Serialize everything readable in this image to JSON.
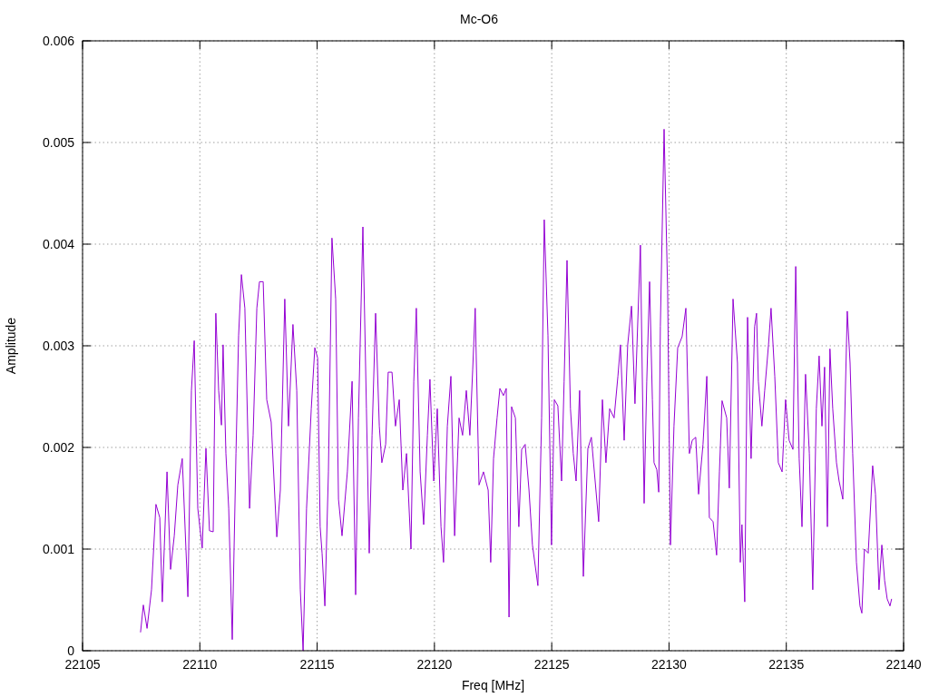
{
  "chart": {
    "chart_data": {
      "type": "line",
      "grid": true,
      "title": "Mc-O6",
      "xlabel": "Freq [MHz]",
      "ylabel": "Amplitude",
      "xlim": [
        22105,
        22140
      ],
      "ylim": [
        0,
        0.006
      ],
      "xticks": [
        22105,
        22110,
        22115,
        22120,
        22125,
        22130,
        22135,
        22140
      ],
      "yticks": [
        0,
        0.001,
        0.002,
        0.003,
        0.004,
        0.005,
        0.006
      ],
      "x": [
        22107.47,
        22107.59,
        22107.75,
        22107.94,
        22108.13,
        22108.29,
        22108.4,
        22108.6,
        22108.75,
        22108.91,
        22109.06,
        22109.25,
        22109.49,
        22109.64,
        22109.76,
        22109.91,
        22110.1,
        22110.26,
        22110.41,
        22110.57,
        22110.68,
        22110.8,
        22110.92,
        22110.99,
        22111.11,
        22111.23,
        22111.38,
        22111.54,
        22111.65,
        22111.77,
        22111.92,
        22112.12,
        22112.27,
        22112.43,
        22112.54,
        22112.7,
        22112.85,
        22113.04,
        22113.28,
        22113.43,
        22113.62,
        22113.78,
        22113.97,
        22114.13,
        22114.28,
        22114.4,
        22114.55,
        22114.75,
        22114.9,
        22115.02,
        22115.13,
        22115.21,
        22115.33,
        22115.48,
        22115.63,
        22115.79,
        22115.91,
        22116.06,
        22116.29,
        22116.49,
        22116.64,
        22116.76,
        22116.95,
        22117.1,
        22117.22,
        22117.34,
        22117.49,
        22117.65,
        22117.76,
        22117.92,
        22118.03,
        22118.19,
        22118.34,
        22118.5,
        22118.65,
        22118.81,
        22119,
        22119.12,
        22119.23,
        22119.39,
        22119.54,
        22119.7,
        22119.81,
        22119.97,
        22120.12,
        22120.28,
        22120.39,
        22120.55,
        22120.7,
        22120.86,
        22121.05,
        22121.2,
        22121.36,
        22121.51,
        22121.63,
        22121.74,
        22121.9,
        22122.09,
        22122.29,
        22122.4,
        22122.52,
        22122.67,
        22122.79,
        22122.94,
        22123.06,
        22123.18,
        22123.29,
        22123.45,
        22123.6,
        22123.72,
        22123.87,
        22124.03,
        22124.18,
        22124.41,
        22124.57,
        22124.68,
        22124.84,
        22124.99,
        22125.11,
        22125.26,
        22125.42,
        22125.53,
        22125.65,
        22125.8,
        22125.92,
        22126.04,
        22126.19,
        22126.35,
        22126.54,
        22126.69,
        22126.85,
        22127,
        22127.16,
        22127.31,
        22127.47,
        22127.66,
        22127.82,
        22127.93,
        22128.09,
        22128.24,
        22128.4,
        22128.55,
        22128.78,
        22128.94,
        22129.05,
        22129.17,
        22129.29,
        22129.36,
        22129.48,
        22129.56,
        22129.63,
        22129.79,
        22129.94,
        22130.06,
        22130.21,
        22130.37,
        22130.56,
        22130.72,
        22130.87,
        22130.99,
        22131.14,
        22131.26,
        22131.45,
        22131.61,
        22131.72,
        22131.88,
        22132.03,
        22132.15,
        22132.26,
        22132.46,
        22132.57,
        22132.73,
        22132.92,
        22133.04,
        22133.11,
        22133.23,
        22133.35,
        22133.5,
        22133.65,
        22133.73,
        22133.81,
        22133.96,
        22134.08,
        22134.24,
        22134.35,
        22134.51,
        22134.66,
        22134.82,
        22134.97,
        22135.12,
        22135.28,
        22135.4,
        22135.55,
        22135.67,
        22135.82,
        22135.98,
        22136.13,
        22136.28,
        22136.4,
        22136.52,
        22136.63,
        22136.75,
        22136.86,
        22136.98,
        22137.14,
        22137.25,
        22137.41,
        22137.6,
        22137.72,
        22137.83,
        22137.99,
        22138.14,
        22138.22,
        22138.33,
        22138.49,
        22138.68,
        22138.8,
        22138.95,
        22139.07,
        22139.19,
        22139.3,
        22139.42,
        22139.49
      ],
      "series": [
        {
          "color": "#9400d3",
          "values": [
            0.00018,
            0.00045,
            0.00022,
            0.0006,
            0.00144,
            0.00131,
            0.00048,
            0.00176,
            0.0008,
            0.00113,
            0.00163,
            0.00189,
            0.00053,
            0.00256,
            0.00305,
            0.0014,
            0.00101,
            0.00199,
            0.00118,
            0.00117,
            0.00332,
            0.00256,
            0.00222,
            0.00301,
            0.00194,
            0.0014,
            0.00011,
            0.00194,
            0.0031,
            0.0037,
            0.00337,
            0.0014,
            0.00212,
            0.00337,
            0.00363,
            0.00363,
            0.00247,
            0.00225,
            0.00112,
            0.00158,
            0.00346,
            0.00221,
            0.00321,
            0.00256,
            0.0006,
            0,
            0.0014,
            0.00238,
            0.00298,
            0.00288,
            0.00122,
            0.00096,
            0.00044,
            0.00176,
            0.00406,
            0.00346,
            0.00149,
            0.00113,
            0.00176,
            0.00265,
            0.00055,
            0.00229,
            0.00417,
            0.00238,
            0.00096,
            0.00212,
            0.00332,
            0.00221,
            0.00185,
            0.00203,
            0.00274,
            0.00274,
            0.00221,
            0.00247,
            0.00158,
            0.00194,
            0.001,
            0.00265,
            0.00337,
            0.00176,
            0.00124,
            0.00212,
            0.00267,
            0.00167,
            0.00238,
            0.00122,
            0.00087,
            0.00221,
            0.0027,
            0.00113,
            0.00229,
            0.00212,
            0.00256,
            0.00212,
            0.00276,
            0.00337,
            0.00163,
            0.00176,
            0.00158,
            0.00087,
            0.00189,
            0.00229,
            0.00258,
            0.00251,
            0.00258,
            0.00033,
            0.0024,
            0.00229,
            0.00122,
            0.00198,
            0.00203,
            0.00158,
            0.00104,
            0.00064,
            0.00229,
            0.00424,
            0.0031,
            0.00104,
            0.00247,
            0.00241,
            0.00167,
            0.00265,
            0.00384,
            0.00238,
            0.00194,
            0.00167,
            0.00256,
            0.00073,
            0.00199,
            0.0021,
            0.00167,
            0.00127,
            0.00247,
            0.00185,
            0.00238,
            0.00229,
            0.0027,
            0.00301,
            0.00207,
            0.00301,
            0.00339,
            0.00243,
            0.00399,
            0.00145,
            0.00265,
            0.00363,
            0.00247,
            0.00185,
            0.00178,
            0.00156,
            0.00319,
            0.00513,
            0.00355,
            0.00104,
            0.00221,
            0.00298,
            0.00309,
            0.00337,
            0.00194,
            0.00207,
            0.0021,
            0.00154,
            0.00203,
            0.0027,
            0.00131,
            0.00127,
            0.00094,
            0.00176,
            0.00246,
            0.00229,
            0.0016,
            0.00346,
            0.00283,
            0.00087,
            0.00124,
            0.00048,
            0.00328,
            0.00189,
            0.00319,
            0.00332,
            0.00265,
            0.00221,
            0.00256,
            0.00301,
            0.00337,
            0.0027,
            0.00185,
            0.00176,
            0.00247,
            0.00207,
            0.00198,
            0.00378,
            0.00189,
            0.00122,
            0.00272,
            0.00194,
            0.0006,
            0.00238,
            0.0029,
            0.00221,
            0.00279,
            0.00122,
            0.00297,
            0.00238,
            0.00185,
            0.00167,
            0.00149,
            0.00334,
            0.00283,
            0.00194,
            0.00087,
            0.00044,
            0.00037,
            0.001,
            0.00096,
            0.00182,
            0.00154,
            0.0006,
            0.00104,
            0.00069,
            0.00051,
            0.00044,
            0.00051
          ]
        }
      ]
    }
  }
}
